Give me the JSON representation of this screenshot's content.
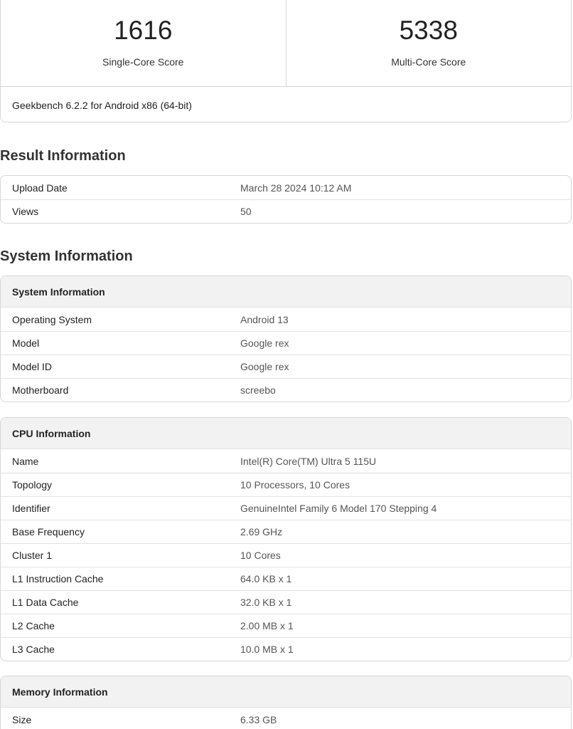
{
  "scores": {
    "single_core": {
      "value": "1616",
      "label": "Single-Core Score"
    },
    "multi_core": {
      "value": "5338",
      "label": "Multi-Core Score"
    },
    "version": "Geekbench 6.2.2 for Android x86 (64-bit)"
  },
  "result_information": {
    "heading": "Result Information",
    "rows": [
      {
        "key": "Upload Date",
        "value": "March 28 2024 10:12 AM"
      },
      {
        "key": "Views",
        "value": "50"
      }
    ]
  },
  "system_information": {
    "heading": "System Information",
    "system": {
      "title": "System Information",
      "rows": [
        {
          "key": "Operating System",
          "value": "Android 13"
        },
        {
          "key": "Model",
          "value": "Google rex"
        },
        {
          "key": "Model ID",
          "value": "Google rex"
        },
        {
          "key": "Motherboard",
          "value": "screebo"
        }
      ]
    },
    "cpu": {
      "title": "CPU Information",
      "rows": [
        {
          "key": "Name",
          "value": "Intel(R) Core(TM) Ultra 5 115U"
        },
        {
          "key": "Topology",
          "value": "10 Processors, 10 Cores"
        },
        {
          "key": "Identifier",
          "value": "GenuineIntel Family 6 Model 170 Stepping 4"
        },
        {
          "key": "Base Frequency",
          "value": "2.69 GHz"
        },
        {
          "key": "Cluster 1",
          "value": "10 Cores"
        },
        {
          "key": "L1 Instruction Cache",
          "value": "64.0 KB x 1"
        },
        {
          "key": "L1 Data Cache",
          "value": "32.0 KB x 1"
        },
        {
          "key": "L2 Cache",
          "value": "2.00 MB x 1"
        },
        {
          "key": "L3 Cache",
          "value": "10.0 MB x 1"
        }
      ]
    },
    "memory": {
      "title": "Memory Information",
      "rows": [
        {
          "key": "Size",
          "value": "6.33 GB"
        }
      ]
    }
  }
}
